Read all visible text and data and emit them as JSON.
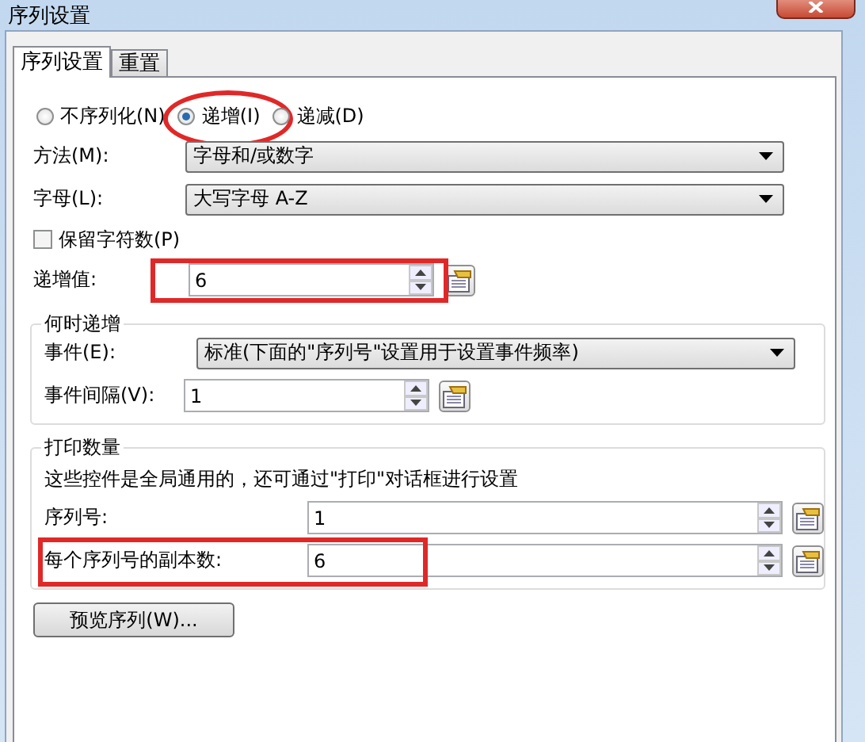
{
  "window": {
    "title": "序列设置"
  },
  "tabs": [
    {
      "label": "序列设置",
      "selected": true
    },
    {
      "label": "重置",
      "selected": false
    }
  ],
  "mode_options": [
    {
      "label": "不序列化(N)",
      "selected": false,
      "highlighted": false
    },
    {
      "label": "递增(I)",
      "selected": true,
      "highlighted": true
    },
    {
      "label": "递减(D)",
      "selected": false,
      "highlighted": false
    }
  ],
  "method": {
    "label": "方法(M):",
    "value": "字母和/或数字"
  },
  "letters": {
    "label": "字母(L):",
    "value": "大写字母 A-Z"
  },
  "keep_count": {
    "label": "保留字符数(P)",
    "checked": false
  },
  "increment": {
    "label": "递增值:",
    "value": "6",
    "highlighted": true
  },
  "when_group": {
    "title": "何时递增",
    "event": {
      "label": "事件(E):",
      "value": "标准(下面的\"序列号\"设置用于设置事件频率)"
    },
    "interval": {
      "label": "事件间隔(V):",
      "value": "1"
    }
  },
  "print_group": {
    "title": "打印数量",
    "description": "这些控件是全局通用的，还可通过\"打印\"对话框进行设置",
    "serial": {
      "label": "序列号:",
      "value": "1",
      "highlighted": false
    },
    "copies": {
      "label": "每个序列号的副本数:",
      "value": "6",
      "highlighted": true
    }
  },
  "preview_button": "预览序列(W)..."
}
